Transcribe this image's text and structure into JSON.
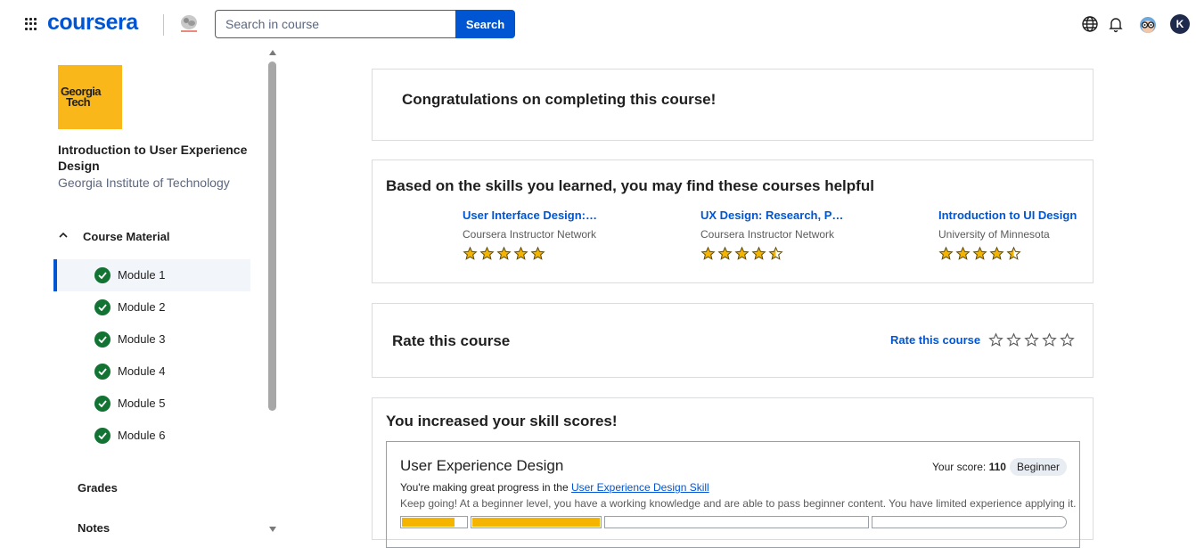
{
  "header": {
    "logo_text": "coursera",
    "search_placeholder": "Search in course",
    "search_button": "Search",
    "avatar_initial": "K"
  },
  "sidebar": {
    "university_logo_text": "Georgia Tech",
    "course_title": "Introduction to User Experience Design",
    "university": "Georgia Institute of Technology",
    "section_label": "Course Material",
    "modules": [
      {
        "label": "Module 1",
        "active": true
      },
      {
        "label": "Module 2",
        "active": false
      },
      {
        "label": "Module 3",
        "active": false
      },
      {
        "label": "Module 4",
        "active": false
      },
      {
        "label": "Module 5",
        "active": false
      },
      {
        "label": "Module 6",
        "active": false
      }
    ],
    "grades_label": "Grades",
    "notes_label": "Notes"
  },
  "main": {
    "congrats_title": "Congratulations on completing this course!",
    "recommendations": {
      "title": "Based on the skills you learned, you may find these courses helpful",
      "items": [
        {
          "title": "User Interface Design:…",
          "provider": "Coursera Instructor Network",
          "rating": 5
        },
        {
          "title": "UX Design: Research, P…",
          "provider": "Coursera Instructor Network",
          "rating": 4.5
        },
        {
          "title": "Introduction to UI Design",
          "provider": "University of Minnesota",
          "rating": 4.5
        }
      ]
    },
    "rate": {
      "title": "Rate this course",
      "link": "Rate this course"
    },
    "skills": {
      "title": "You increased your skill scores!",
      "skill_name": "User Experience Design",
      "score_label": "Your score:",
      "score_value": "110",
      "level_badge": "Beginner",
      "progress_prefix": "You're making great progress in the",
      "progress_link": "User Experience Design Skill",
      "description": "Keep going! At a beginner level, you have a working knowledge and are able to pass beginner content. You have limited experience applying it.",
      "segment_fill_fractions": [
        1,
        1,
        0,
        0
      ],
      "subsegment_fill_fraction": [
        0.82,
        1,
        0,
        0
      ]
    }
  },
  "colors": {
    "brand": "#0056d2",
    "check_green": "#137333",
    "star": "#f4b400",
    "georgia_tech_gold": "#f9b719"
  }
}
